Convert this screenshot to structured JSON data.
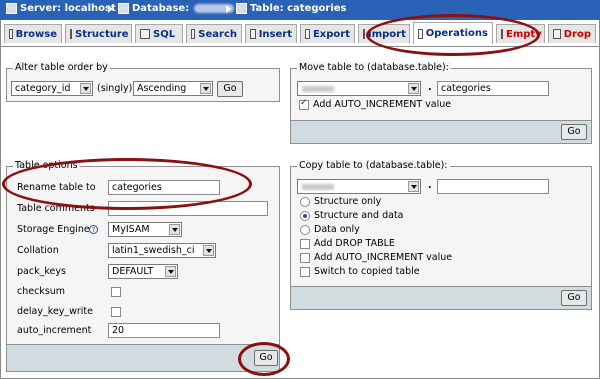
{
  "breadcrumb": {
    "server": "Server: localhost",
    "database": "Database:",
    "table": "Table: categories"
  },
  "tabs": [
    {
      "label": "Browse"
    },
    {
      "label": "Structure"
    },
    {
      "label": "SQL"
    },
    {
      "label": "Search"
    },
    {
      "label": "Insert"
    },
    {
      "label": "Export"
    },
    {
      "label": "Import"
    },
    {
      "label": "Operations",
      "active": true
    },
    {
      "label": "Empty",
      "danger": true
    },
    {
      "label": "Drop",
      "danger": true
    }
  ],
  "alter_order": {
    "legend": "Alter table order by",
    "column_value": "category_id",
    "singly_label": "(singly)",
    "direction_value": "Ascending",
    "go_label": "Go"
  },
  "move_table": {
    "legend": "Move table to (database.table):",
    "dot": ".",
    "table_value": "categories",
    "auto_increment_label": "Add AUTO_INCREMENT value",
    "auto_increment_checked": true,
    "go_label": "Go"
  },
  "table_options": {
    "legend": "Table options",
    "rename_label": "Rename table to",
    "rename_value": "categories",
    "comments_label": "Table comments",
    "comments_value": "",
    "engine_label": "Storage Engine",
    "engine_help": "?",
    "engine_value": "MyISAM",
    "collation_label": "Collation",
    "collation_value": "latin1_swedish_ci",
    "pack_keys_label": "pack_keys",
    "pack_keys_value": "DEFAULT",
    "checksum_label": "checksum",
    "delay_key_write_label": "delay_key_write",
    "auto_increment_label": "auto_increment",
    "auto_increment_value": "20",
    "go_label": "Go"
  },
  "copy_table": {
    "legend": "Copy table to (database.table):",
    "dot": ".",
    "table_value": "",
    "options": [
      {
        "label": "Structure only",
        "selected": false
      },
      {
        "label": "Structure and data",
        "selected": true
      },
      {
        "label": "Data only",
        "selected": false
      }
    ],
    "checkboxes": [
      {
        "label": "Add DROP TABLE",
        "checked": false
      },
      {
        "label": "Add AUTO_INCREMENT value",
        "checked": false
      },
      {
        "label": "Switch to copied table",
        "checked": false
      }
    ],
    "go_label": "Go"
  },
  "annotation_color": "#8b1010"
}
